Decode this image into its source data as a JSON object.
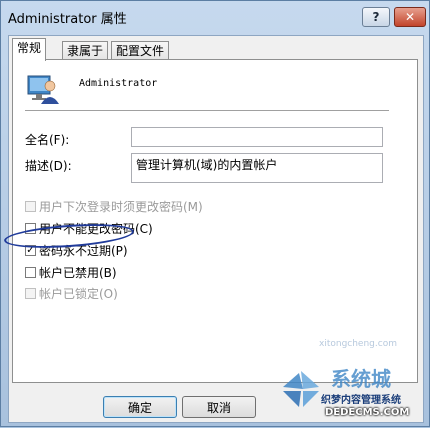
{
  "window": {
    "title": "Administrator 属性",
    "help_label": "?",
    "close_label": "✕"
  },
  "tabs": [
    {
      "label": "常规",
      "active": true
    },
    {
      "label": "隶属于",
      "active": false
    },
    {
      "label": "配置文件",
      "active": false
    }
  ],
  "user": {
    "name": "Administrator"
  },
  "fields": {
    "fullname_label": "全名(F):",
    "fullname_value": "",
    "description_label": "描述(D):",
    "description_value": "管理计算机(域)的内置帐户"
  },
  "checkboxes": [
    {
      "label": "用户下次登录时须更改密码(M)",
      "checked": false,
      "disabled": true
    },
    {
      "label": "用户不能更改密码(C)",
      "checked": false,
      "disabled": false
    },
    {
      "label": "密码永不过期(P)",
      "checked": true,
      "disabled": false
    },
    {
      "label": "帐户已禁用(B)",
      "checked": false,
      "disabled": false
    },
    {
      "label": "帐户已锁定(O)",
      "checked": false,
      "disabled": true
    }
  ],
  "buttons": {
    "ok_label": "确定",
    "cancel_label": "取消"
  },
  "watermark": {
    "brand": "系统城",
    "site1": "织梦内容管理系统",
    "site2": "DEDECMS.COM",
    "url": "xitongcheng.com"
  },
  "colors": {
    "title_gradient": "#c6d9ee",
    "close_button": "#c2442b",
    "annotation_circle": "#1f3a9a"
  }
}
